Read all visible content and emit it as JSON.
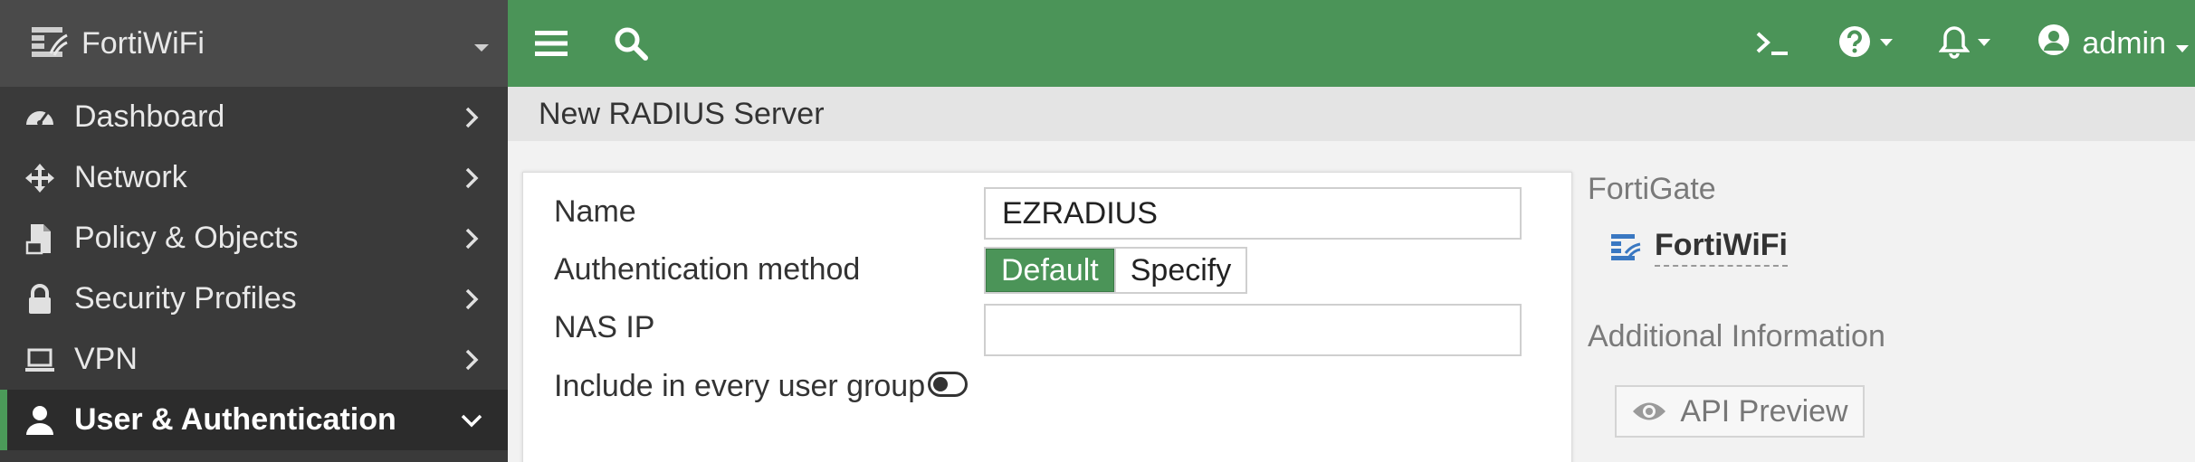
{
  "sidebar": {
    "brand": "FortiWiFi",
    "items": [
      {
        "label": "Dashboard",
        "icon": "dashboard-icon"
      },
      {
        "label": "Network",
        "icon": "network-icon"
      },
      {
        "label": "Policy & Objects",
        "icon": "policy-icon"
      },
      {
        "label": "Security Profiles",
        "icon": "lock-icon"
      },
      {
        "label": "VPN",
        "icon": "laptop-icon"
      },
      {
        "label": "User & Authentication",
        "icon": "user-icon"
      }
    ]
  },
  "topbar": {
    "user": "admin"
  },
  "page": {
    "title": "New RADIUS Server"
  },
  "form": {
    "name_label": "Name",
    "name_value": "EZRADIUS",
    "auth_label": "Authentication method",
    "auth_options": [
      "Default",
      "Specify"
    ],
    "auth_selected": "Default",
    "nas_ip_label": "NAS IP",
    "nas_ip_value": "",
    "include_label": "Include in every user group",
    "include_enabled": false
  },
  "right_panel": {
    "fortigate_title": "FortiGate",
    "device_name": "FortiWiFi",
    "additional_title": "Additional Information",
    "api_preview_label": "API Preview"
  },
  "colors": {
    "accent": "#4b9458",
    "sidebar_bg": "#3a3a3a",
    "sidebar_active_bar": "#4b9a59"
  }
}
